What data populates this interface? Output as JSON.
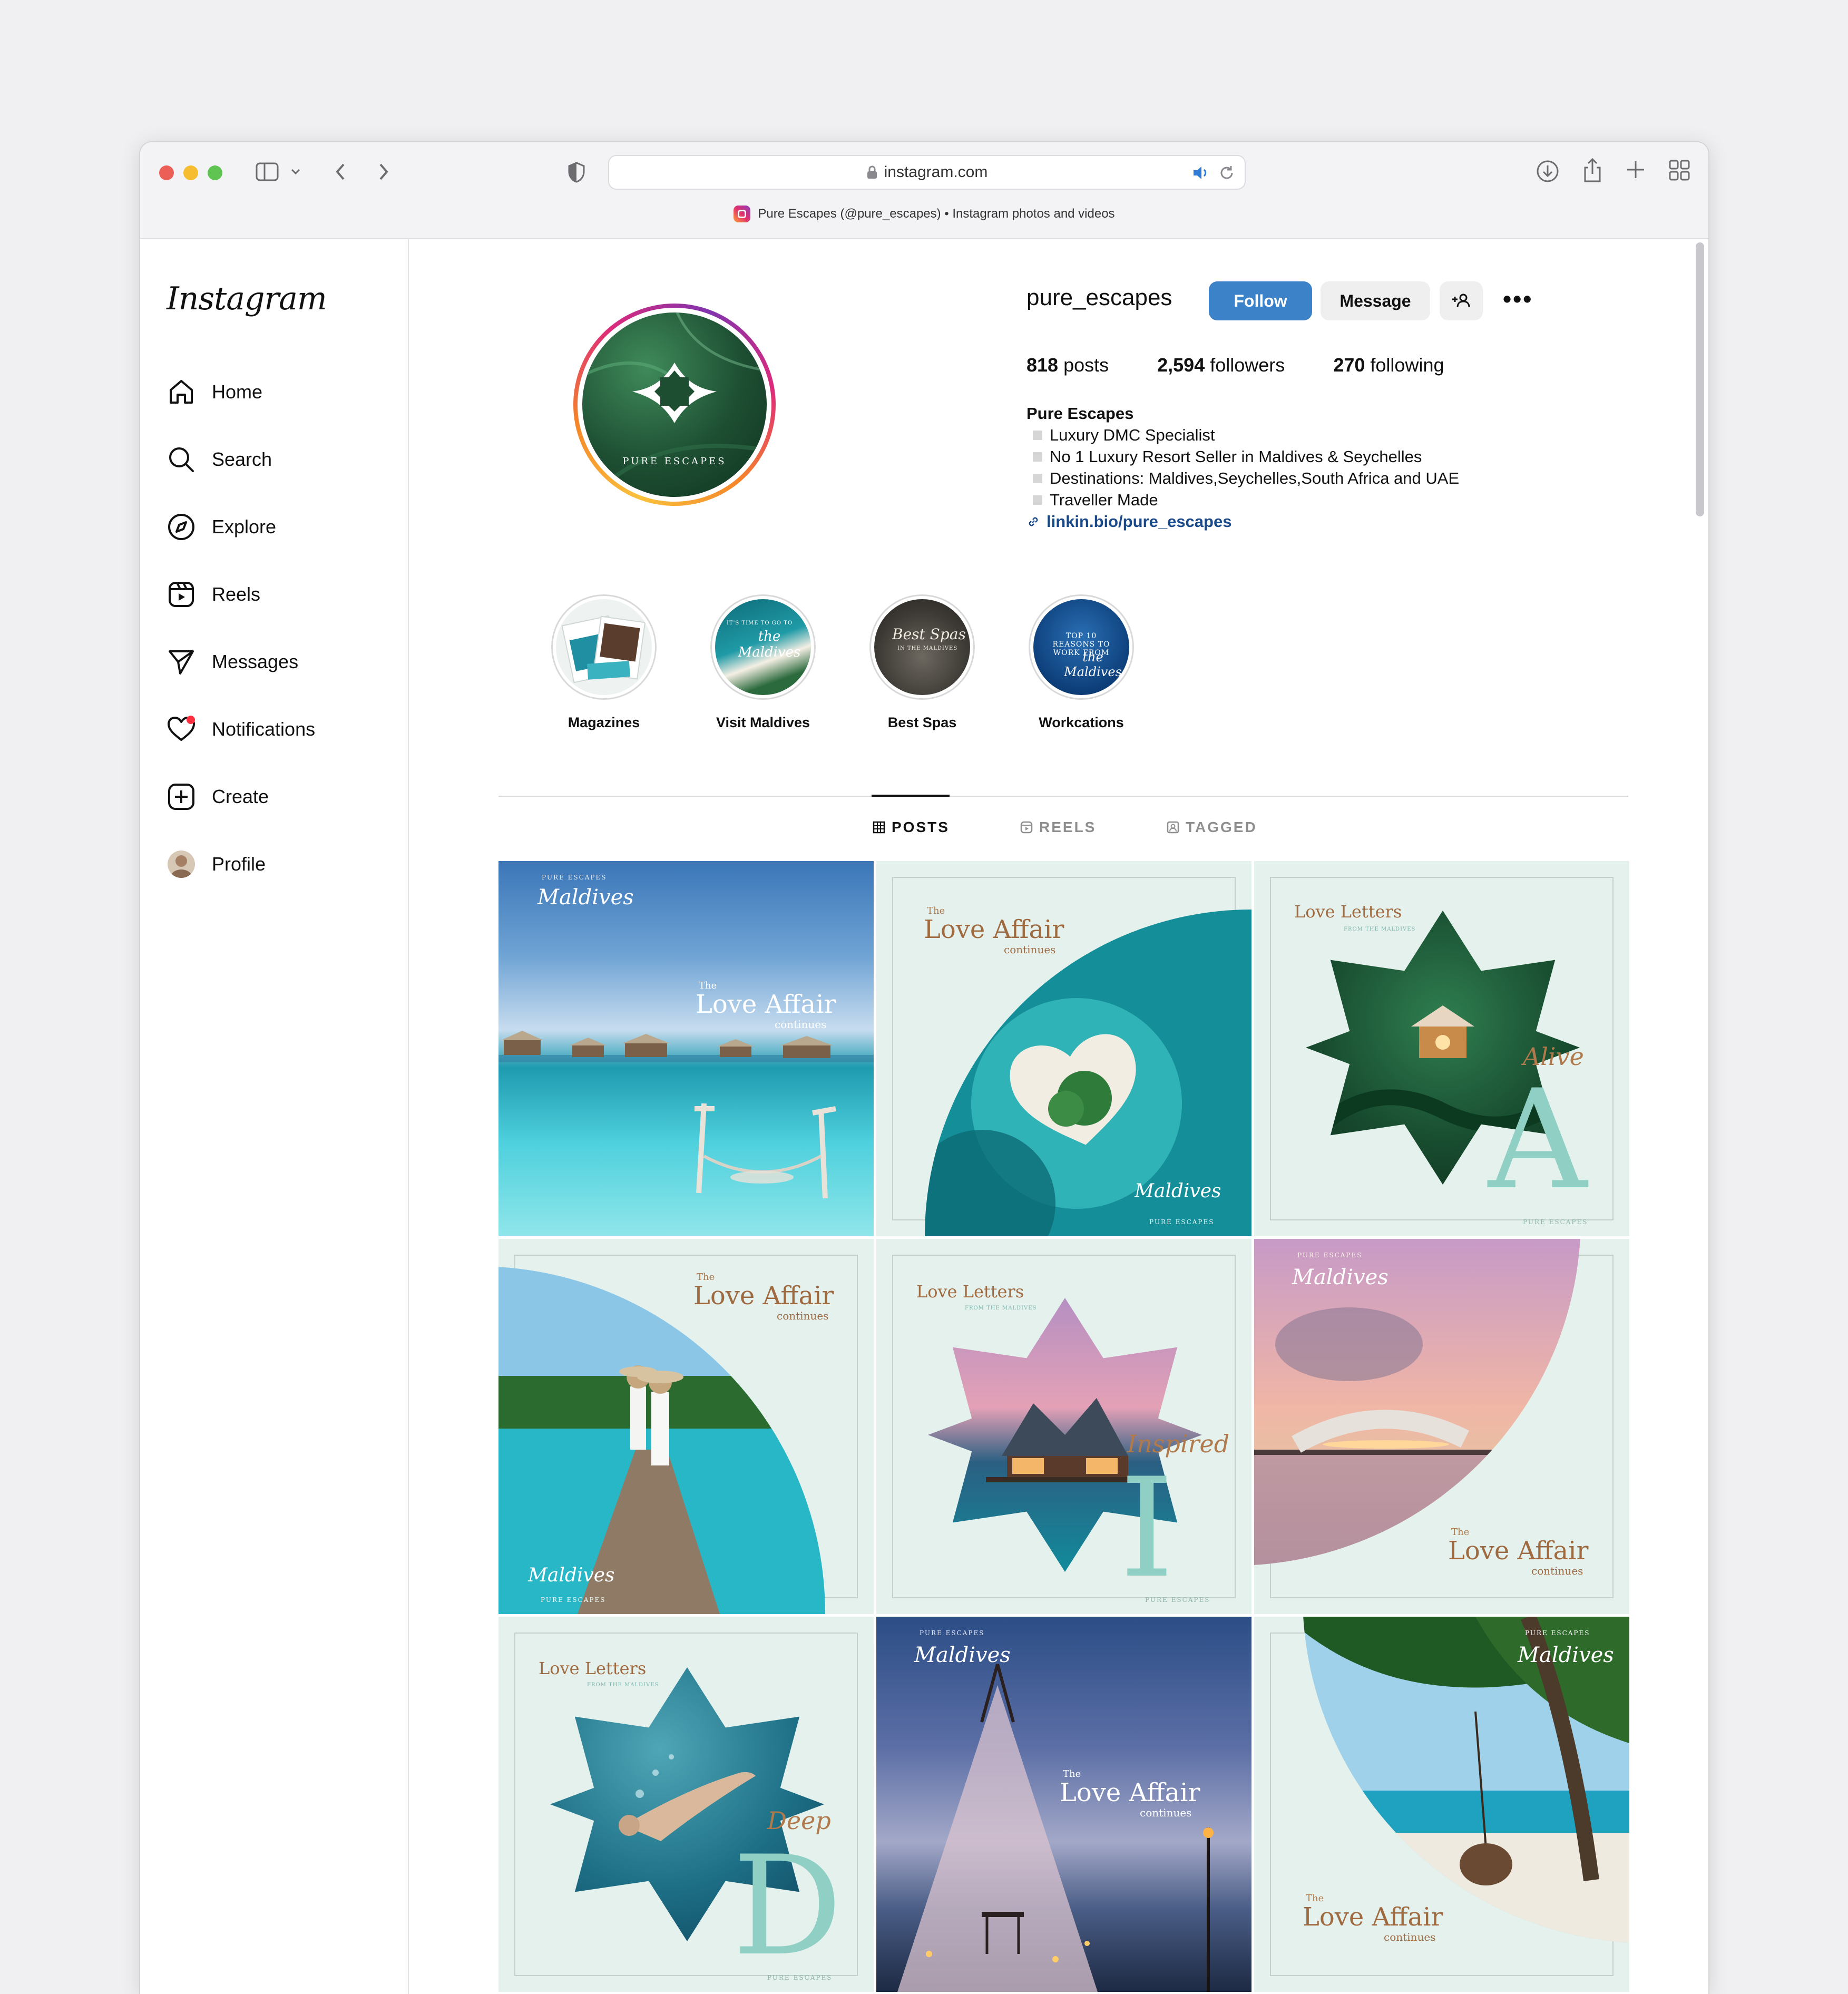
{
  "browser": {
    "url": "instagram.com",
    "tab_title": "Pure Escapes (@pure_escapes) • Instagram photos and videos"
  },
  "sidebar": {
    "logo": "Instagram",
    "items": [
      {
        "label": "Home",
        "icon": "home-icon"
      },
      {
        "label": "Search",
        "icon": "search-icon"
      },
      {
        "label": "Explore",
        "icon": "compass-icon"
      },
      {
        "label": "Reels",
        "icon": "reels-icon"
      },
      {
        "label": "Messages",
        "icon": "send-icon"
      },
      {
        "label": "Notifications",
        "icon": "heart-icon"
      },
      {
        "label": "Create",
        "icon": "plus-square-icon"
      },
      {
        "label": "Profile",
        "icon": "avatar-icon"
      }
    ]
  },
  "profile": {
    "username": "pure_escapes",
    "follow_label": "Follow",
    "message_label": "Message",
    "avatar_text": "PURE ESCAPES",
    "posts_count": "818",
    "posts_label": "posts",
    "followers_count": "2,594",
    "followers_label": "followers",
    "following_count": "270",
    "following_label": "following",
    "bio_name": "Pure Escapes",
    "bio_lines": [
      "Luxury DMC Specialist",
      "No 1 Luxury Resort Seller in Maldives & Seychelles",
      "Destinations: Maldives,Seychelles,South Africa and UAE",
      "Traveller Made"
    ],
    "bio_link": "linkin.bio/pure_escapes"
  },
  "highlights": [
    {
      "label": "Magazines"
    },
    {
      "label": "Visit Maldives",
      "cover_text": "IT'S TIME TO GO TO",
      "cover_script": "the Maldives"
    },
    {
      "label": "Best Spas",
      "cover_script": "Best Spas",
      "cover_text": "IN THE MALDIVES"
    },
    {
      "label": "Workcations",
      "cover_text": "TOP 10 REASONS TO WORK FROM",
      "cover_script": "the Maldives"
    }
  ],
  "tabs": {
    "posts": "POSTS",
    "reels": "REELS",
    "tagged": "TAGGED"
  },
  "posts": {
    "brand": "PURE ESCAPES",
    "maldives": "Maldives",
    "the": "The",
    "love_affair": "Love Affair",
    "continues": "continues",
    "love_letters": "Love Letters",
    "from_maldives": "FROM THE MALDIVES",
    "alive_word": "Alive",
    "alive_letter": "A",
    "inspired_word": "Inspired",
    "inspired_letter": "I",
    "deep_word": "Deep",
    "deep_letter": "D"
  }
}
